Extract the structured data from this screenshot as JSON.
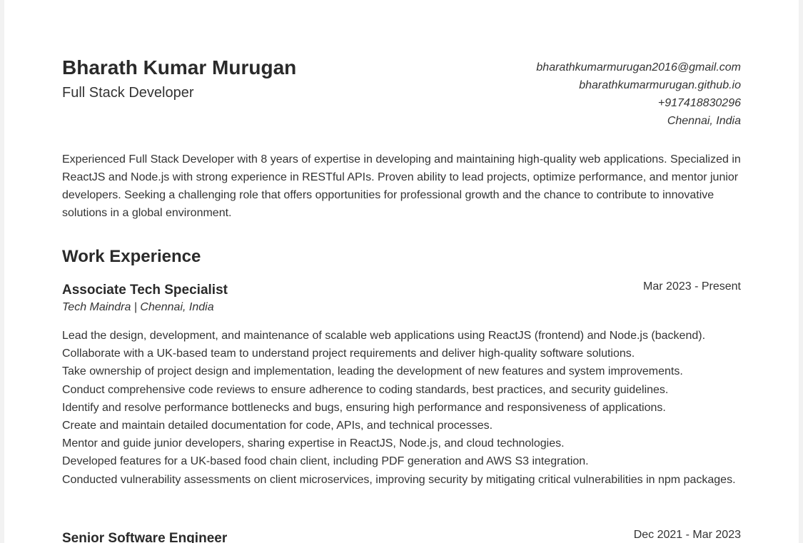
{
  "header": {
    "name": "Bharath Kumar Murugan",
    "role": "Full Stack Developer",
    "contact": {
      "email": "bharathkumarmurugan2016@gmail.com",
      "website": "bharathkumarmurugan.github.io",
      "phone": "+917418830296",
      "location": "Chennai, India"
    }
  },
  "summary": "Experienced Full Stack Developer with 8 years of expertise in developing and maintaining high-quality web applications. Specialized in ReactJS and Node.js with strong experience in RESTful APIs. Proven ability to lead projects, optimize performance, and mentor junior developers. Seeking a challenging role that offers opportunities for professional growth and the chance to contribute to innovative solutions in a global environment.",
  "work_experience": {
    "heading": "Work Experience",
    "jobs": [
      {
        "title": "Associate Tech Specialist",
        "company": "Tech Maindra | Chennai, India",
        "dates": "Mar 2023 - Present",
        "duties": [
          "Lead the design, development, and maintenance of scalable web applications using ReactJS (frontend) and Node.js (backend).",
          "Collaborate with a UK-based team to understand project requirements and deliver high-quality software solutions.",
          "Take ownership of project design and implementation, leading the development of new features and system improvements.",
          "Conduct comprehensive code reviews to ensure adherence to coding standards, best practices, and security guidelines.",
          "Identify and resolve performance bottlenecks and bugs, ensuring high performance and responsiveness of applications.",
          "Create and maintain detailed documentation for code, APIs, and technical processes.",
          "Mentor and guide junior developers, sharing expertise in ReactJS, Node.js, and cloud technologies.",
          "Developed features for a UK-based food chain client, including PDF generation and AWS S3 integration.",
          "Conducted vulnerability assessments on client microservices, improving security by mitigating critical vulnerabilities in npm packages."
        ]
      },
      {
        "title": "Senior Software Engineer",
        "dates": "Dec 2021 - Mar 2023"
      }
    ]
  }
}
